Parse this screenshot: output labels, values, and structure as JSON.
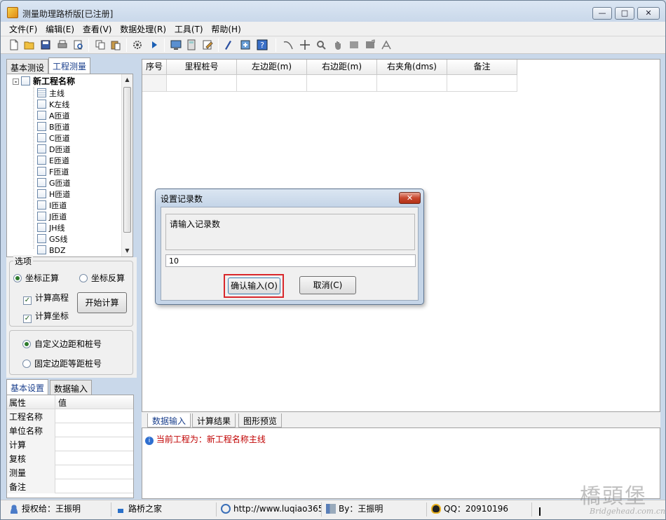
{
  "window": {
    "title": "测量助理路桥版[已注册]"
  },
  "menu": [
    "文件(F)",
    "编辑(E)",
    "查看(V)",
    "数据处理(R)",
    "工具(T)",
    "帮助(H)"
  ],
  "toolbar_icons": [
    "new-file-icon",
    "open-folder-icon",
    "save-icon",
    "print-icon",
    "print-preview-icon",
    "copy-icon",
    "paste-icon",
    "gear-icon",
    "play-icon",
    "screen-icon",
    "calculator-icon",
    "edit-icon",
    "draw-icon",
    "export-icon",
    "help-icon",
    "curve-icon",
    "crosshair-icon",
    "zoom-icon",
    "pan-hand-icon",
    "rectangle-icon",
    "picture-icon",
    "measure-icon"
  ],
  "left_tabs": [
    {
      "label": "基本测设",
      "active": false
    },
    {
      "label": "工程测量",
      "active": true
    }
  ],
  "tree": {
    "root": "新工程名称",
    "children": [
      "主线",
      "K左线",
      "A匝道",
      "B匝道",
      "C匝道",
      "D匝道",
      "E匝道",
      "F匝道",
      "G匝道",
      "H匝道",
      "I匝道",
      "J匝道",
      "JH线",
      "GS线",
      "BDZ"
    ]
  },
  "options": {
    "label": "选项",
    "coord_forward": "坐标正算",
    "coord_inverse": "坐标反算",
    "calc_elevation": "计算高程",
    "calc_coord": "计算坐标",
    "start_button": "开始计算",
    "custom_offset": "自定义边距和桩号",
    "fixed_offset": "固定边距等距桩号"
  },
  "prop_tabs": [
    {
      "label": "基本设置",
      "active": true
    },
    {
      "label": "数据输入",
      "active": false
    }
  ],
  "property_grid": {
    "headers": [
      "属性",
      "值"
    ],
    "rows": [
      "工程名称",
      "单位名称",
      "计算",
      "复核",
      "测量",
      "备注"
    ]
  },
  "grid": {
    "columns": [
      "序号",
      "里程桩号",
      "左边距(m)",
      "右边距(m)",
      "右夹角(dms)",
      "备注"
    ]
  },
  "bottom_tabs": [
    {
      "label": "数据输入",
      "active": true
    },
    {
      "label": "计算结果",
      "active": false
    },
    {
      "label": "图形预览",
      "active": false
    }
  ],
  "log": {
    "message": "当前工程为：新工程名称主线"
  },
  "status": {
    "license": "授权给：王振明",
    "home": "路桥之家",
    "url": "http://www.luqiao365.",
    "by": "By：王振明",
    "qq": "QQ：20910196"
  },
  "dialog": {
    "title": "设置记录数",
    "prompt": "请输入记录数",
    "value": "10",
    "ok": "确认输入(O)",
    "cancel": "取消(C)"
  },
  "watermark": {
    "text": "橋頭堡",
    "sub": "Bridgehead.com.cn"
  },
  "colors": {
    "accent_red": "#d9282c",
    "log_text": "#c00000",
    "tab_active_text": "#1a3f8c"
  }
}
